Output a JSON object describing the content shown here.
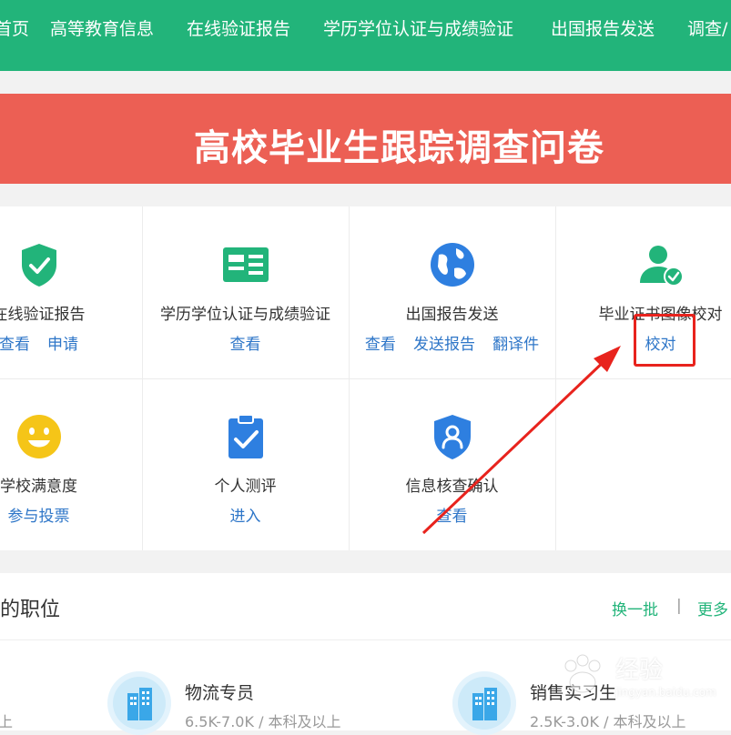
{
  "nav": {
    "items": [
      "首页",
      "高等教育信息",
      "在线验证报告",
      "学历学位认证与成绩验证",
      "出国报告发送",
      "调查/"
    ]
  },
  "banner": {
    "title": "高校毕业生跟踪调查问卷"
  },
  "services": [
    {
      "title": "在线验证报告",
      "icon": "shield-check-icon",
      "links": [
        "查看",
        "申请"
      ]
    },
    {
      "title": "学历学位认证与成绩验证",
      "icon": "id-card-icon",
      "links": [
        "查看"
      ]
    },
    {
      "title": "出国报告发送",
      "icon": "globe-icon",
      "links": [
        "查看",
        "发送报告",
        "翻译件"
      ]
    },
    {
      "title": "毕业证书图像校对",
      "icon": "user-check-icon",
      "links": [
        "校对"
      ]
    },
    {
      "title": "学校满意度",
      "icon": "smiley-icon",
      "links": [
        "参与投票"
      ]
    },
    {
      "title": "个人测评",
      "icon": "clipboard-check-icon",
      "links": [
        "进入"
      ]
    },
    {
      "title": "信息核查确认",
      "icon": "user-shield-icon",
      "links": [
        "查看"
      ]
    }
  ],
  "jobs": {
    "title": "你的职位",
    "refresh_label": "换一批",
    "separator": "|",
    "more_label": "更多",
    "items": [
      {
        "name": "物流专员",
        "salary": "6.5K-7.0K",
        "sep": "/",
        "education": "本科及以上"
      },
      {
        "name": "销售实习生",
        "salary": "2.5K-3.0K",
        "sep": "/",
        "education": "本科及以上"
      }
    ],
    "left_partial_meta": "上"
  },
  "watermark": {
    "text": "经验",
    "url": "jingyan.baidu.com"
  },
  "colors": {
    "nav_bg": "#22b47a",
    "banner_bg": "#ec5f54",
    "link": "#2e76c8",
    "icon_green": "#22b47a",
    "icon_blue": "#2e7fe0",
    "icon_yellow": "#f5c518",
    "annotation_red": "#e8231d"
  }
}
